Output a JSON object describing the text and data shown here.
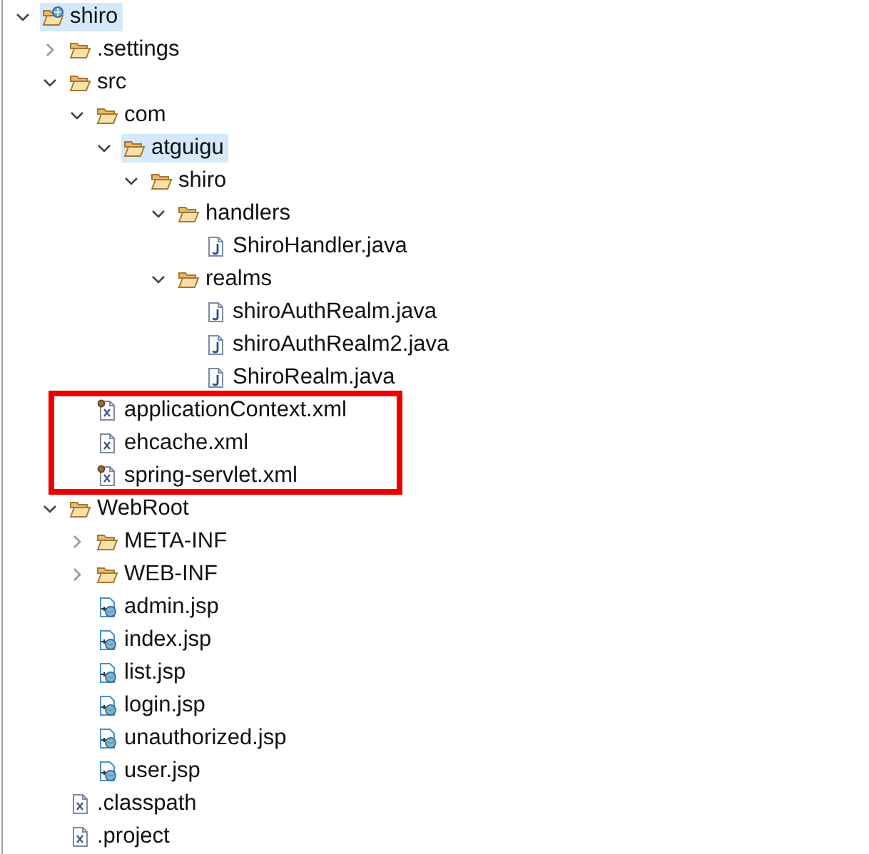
{
  "tree": [
    {
      "label": "shiro",
      "kind": "project",
      "expanded": true,
      "selected": true,
      "children": [
        {
          "label": ".settings",
          "kind": "folder",
          "expanded": false,
          "selected": false
        },
        {
          "label": "src",
          "kind": "folder",
          "expanded": true,
          "selected": false,
          "children": [
            {
              "label": "com",
              "kind": "folder",
              "expanded": true,
              "selected": false,
              "children": [
                {
                  "label": "atguigu",
                  "kind": "folder",
                  "expanded": true,
                  "selected": true,
                  "children": [
                    {
                      "label": "shiro",
                      "kind": "folder",
                      "expanded": true,
                      "selected": false,
                      "children": [
                        {
                          "label": "handlers",
                          "kind": "folder",
                          "expanded": true,
                          "selected": false,
                          "children": [
                            {
                              "label": "ShiroHandler.java",
                              "kind": "java",
                              "selected": false
                            }
                          ]
                        },
                        {
                          "label": "realms",
                          "kind": "folder",
                          "expanded": true,
                          "selected": false,
                          "children": [
                            {
                              "label": "shiroAuthRealm.java",
                              "kind": "java",
                              "selected": false
                            },
                            {
                              "label": "shiroAuthRealm2.java",
                              "kind": "java",
                              "selected": false
                            },
                            {
                              "label": "ShiroRealm.java",
                              "kind": "java",
                              "selected": false
                            }
                          ]
                        }
                      ]
                    }
                  ]
                }
              ]
            },
            {
              "label": "applicationContext.xml",
              "kind": "spring-xml",
              "selected": false,
              "annotated": true
            },
            {
              "label": "ehcache.xml",
              "kind": "xml",
              "selected": false,
              "annotated": true
            },
            {
              "label": "spring-servlet.xml",
              "kind": "spring-xml",
              "selected": false,
              "annotated": true
            }
          ]
        },
        {
          "label": "WebRoot",
          "kind": "folder",
          "expanded": true,
          "selected": false,
          "children": [
            {
              "label": "META-INF",
              "kind": "folder",
              "expanded": false,
              "selected": false
            },
            {
              "label": "WEB-INF",
              "kind": "folder",
              "expanded": false,
              "selected": false
            },
            {
              "label": "admin.jsp",
              "kind": "jsp",
              "selected": false
            },
            {
              "label": "index.jsp",
              "kind": "jsp",
              "selected": false
            },
            {
              "label": "list.jsp",
              "kind": "jsp",
              "selected": false
            },
            {
              "label": "login.jsp",
              "kind": "jsp",
              "selected": false
            },
            {
              "label": "unauthorized.jsp",
              "kind": "jsp",
              "selected": false
            },
            {
              "label": "user.jsp",
              "kind": "jsp",
              "selected": false
            }
          ]
        },
        {
          "label": ".classpath",
          "kind": "xml",
          "selected": false
        },
        {
          "label": ".project",
          "kind": "xml",
          "selected": false
        }
      ]
    }
  ]
}
